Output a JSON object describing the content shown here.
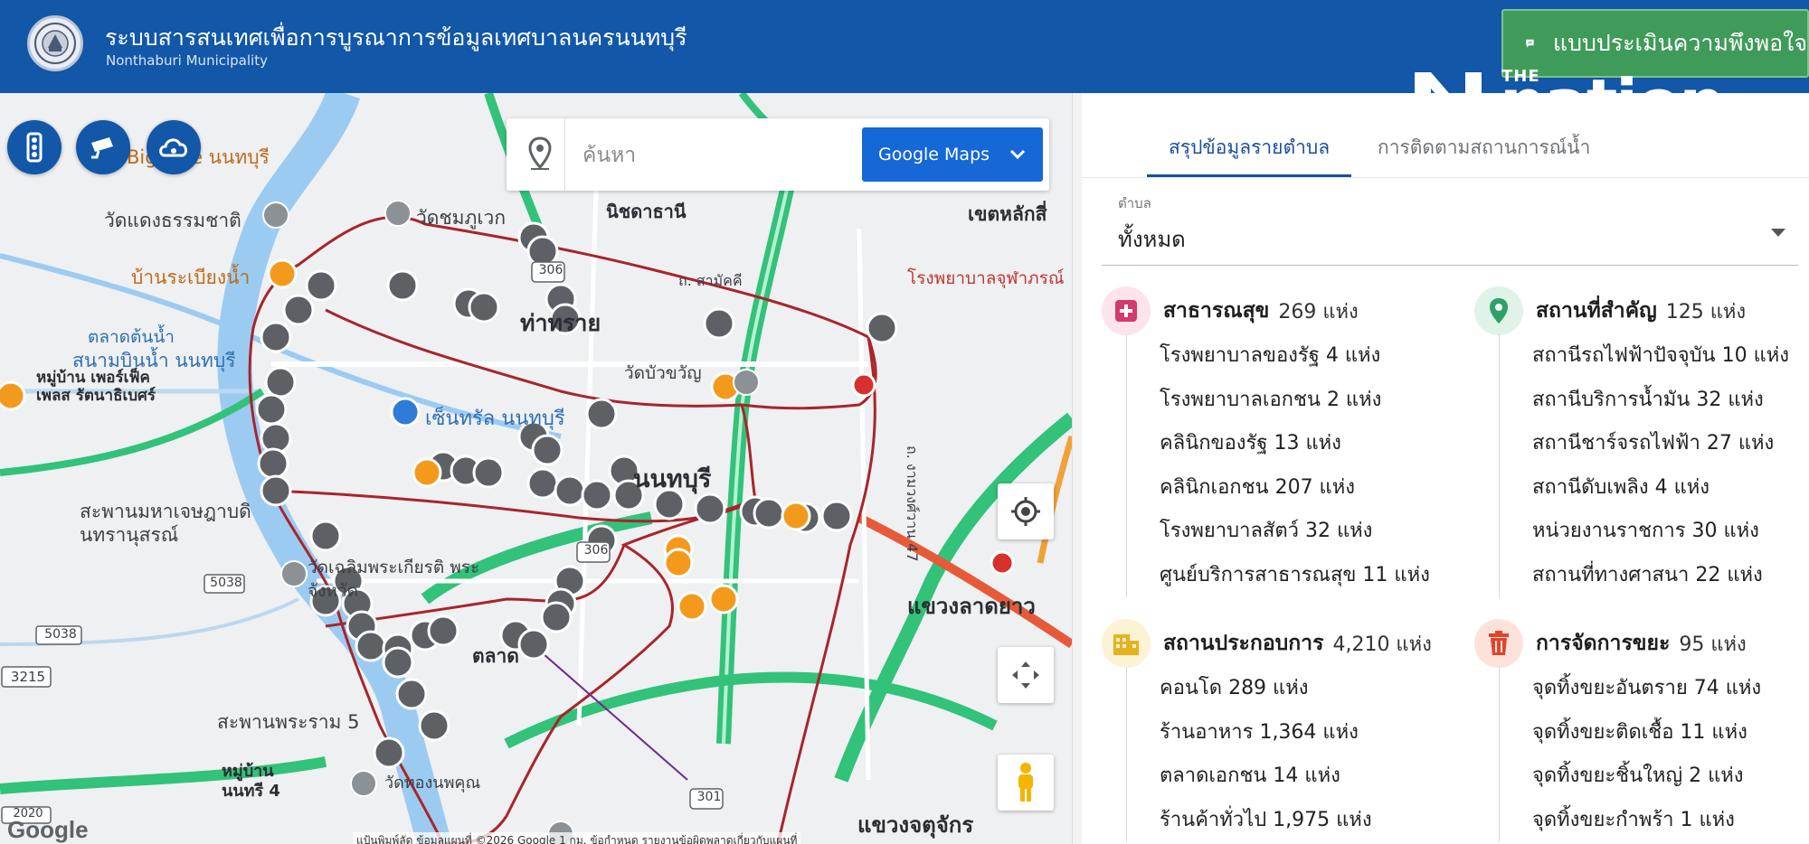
{
  "header": {
    "title": "ระบบสารสนเทศเพื่อการบูรณาการข้อมูลเทศบาลนครนนทบุรี",
    "subtitle": "Nonthaburi Municipality",
    "survey_button": "แบบประเมินความพึงพอใจ"
  },
  "watermark": {
    "the": "THE",
    "nation": "nation"
  },
  "map": {
    "search": {
      "placeholder": "ค้นหา",
      "provider": "Google Maps"
    },
    "labels": {
      "big_tree": "Big Tree นนทบุรี",
      "wat_daeng": "วัดแดงธรรมชาติ",
      "ban_rabiang": "บ้านระเบียงน้ำ",
      "talad_ton": "ตลาดต้นน้ำ",
      "sanam_bin": "สนามบินน้ำ นนทบุรี",
      "muban_pearl": "หมู่บ้าน เพอร์เฟ็คเพลส รัตนาธิเบศร์",
      "wat_chomphu": "วัดชมภูเวก",
      "nichada": "นิชดาธานี",
      "tha_sai": "ท่าทราย",
      "sam_khwae": "ถ. สามัคคี",
      "wat_bua": "วัดบัวขวัญ",
      "wat_chaloem": "วัดเฉลิมพระเกียรติ พระจังหวัด",
      "central": "เซ็นทรัล นนทบุรี",
      "saphan_maha": "สะพานมหาเจษฎาบดินทรานุสรณ์",
      "saphan_rama5": "สะพานพระราม 5",
      "muban_nonthree": "หมู่บ้าน นนทรี 4",
      "khet_lak_si": "เขตหลักสี่",
      "rp_chula": "โรงพยาบาลจุฬาภรณ์",
      "ngam_wong": "ถ. งามวงศ์วาน 47",
      "khwaeng_lat_yao": "แขวงลาดยาว",
      "khwaeng_chatu": "แขวงจตุจักร",
      "mueang": "นนทบุรี",
      "talad": "ตลาด",
      "wat_thong": "วัดทองนพคุณ",
      "r306a": "306",
      "r306b": "306",
      "r301": "301",
      "r5038a": "5038",
      "r5038b": "5038",
      "r3215": "3215",
      "r2020": "2020"
    },
    "google": "Google",
    "attribution": "แป้นพิมพ์ลัด   ข้อมูลแผนที่ ©2026 Google   1 กม.   ข้อกำหนด   รายงานข้อผิดพลาดเกี่ยวกับแผนที่"
  },
  "panel": {
    "tabs": [
      {
        "label": "สรุปข้อมูลรายตำบล",
        "active": true
      },
      {
        "label": "การติดตามสถานการณ์น้ำ",
        "active": false
      }
    ],
    "district_select": {
      "label": "ตำบล",
      "value": "ทั้งหมด"
    },
    "categories": [
      {
        "title": "สาธารณสุข",
        "count": "269 แห่ง",
        "icon": "medical-cross-icon",
        "color": "#d23b6c",
        "items": [
          "โรงพยาบาลของรัฐ 4 แห่ง",
          "โรงพยาบาลเอกชน 2 แห่ง",
          "คลินิกของรัฐ 13 แห่ง",
          "คลินิกเอกชน 207 แห่ง",
          "โรงพยาบาลสัตว์ 32 แห่ง",
          "ศูนย์บริการสาธารณสุข 11 แห่ง"
        ]
      },
      {
        "title": "สถานที่สำคัญ",
        "count": "125 แห่ง",
        "icon": "map-pin-icon",
        "color": "#2ea06a",
        "items": [
          "สถานีรถไฟฟ้าปัจจุบัน 10 แห่ง",
          "สถานีบริการน้ำมัน 32 แห่ง",
          "สถานีชาร์จรถไฟฟ้า 27 แห่ง",
          "สถานีดับเพลิง 4 แห่ง",
          "หน่วยงานราชการ 30 แห่ง",
          "สถานที่ทางศาสนา 22 แห่ง"
        ]
      },
      {
        "title": "สถานประกอบการ",
        "count": "4,210 แห่ง",
        "icon": "building-icon",
        "color": "#e5b21f",
        "items": [
          "คอนโด 289 แห่ง",
          "ร้านอาหาร 1,364 แห่ง",
          "ตลาดเอกชน 14 แห่ง",
          "ร้านค้าทั่วไป 1,975 แห่ง"
        ]
      },
      {
        "title": "การจัดการขยะ",
        "count": "95 แห่ง",
        "icon": "trash-bin-icon",
        "color": "#e0452b",
        "items": [
          "จุดทิ้งขยะอันตราย 74 แห่ง",
          "จุดทิ้งขยะติดเชื้อ 11 แห่ง",
          "จุดทิ้งขยะชิ้นใหญ่ 2 แห่ง",
          "จุดทิ้งขยะกำพร้า 1 แห่ง"
        ]
      }
    ]
  }
}
